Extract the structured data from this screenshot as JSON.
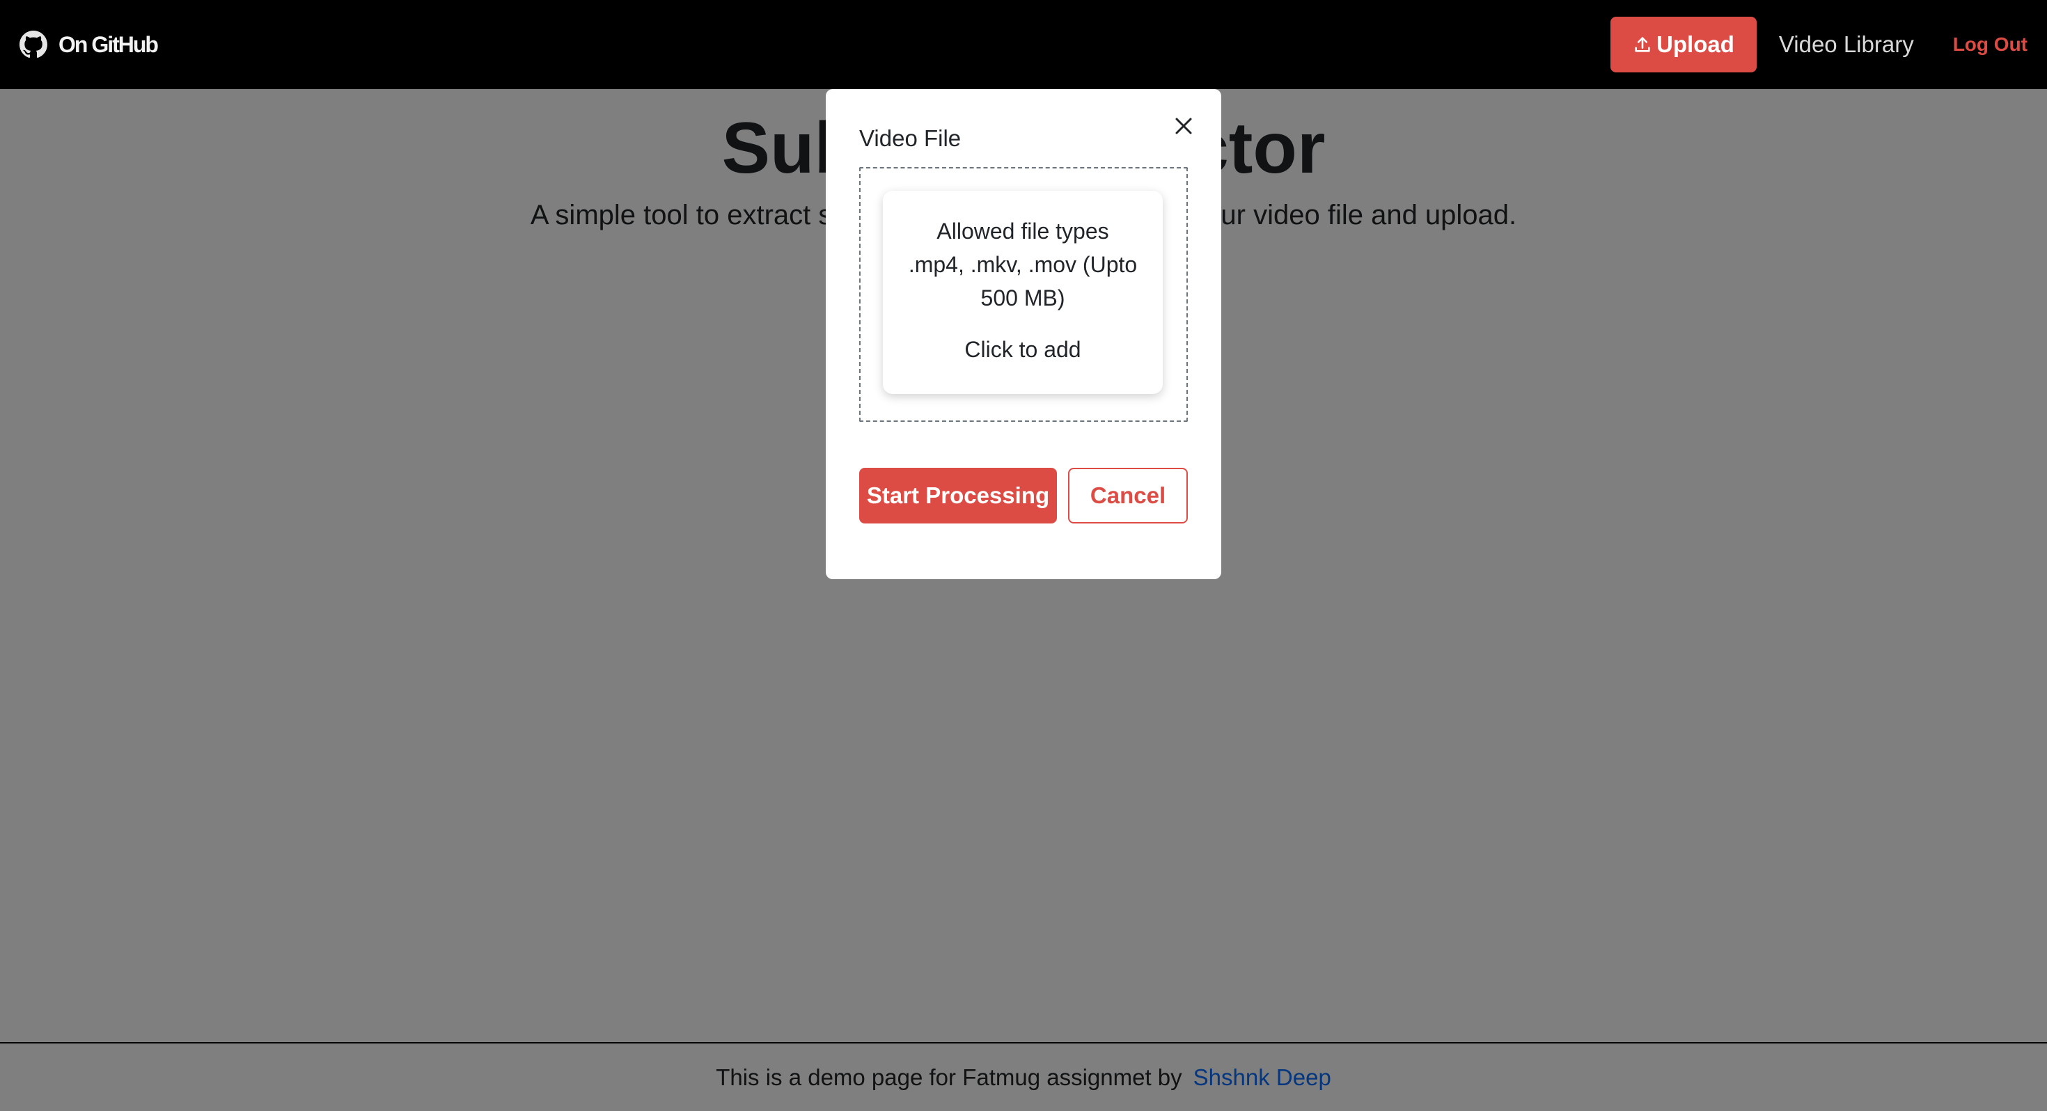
{
  "navbar": {
    "brand": "On GitHub",
    "upload_label": "Upload",
    "library_label": "Video Library",
    "logout_label": "Log Out"
  },
  "main": {
    "title": "Subtitle Extractor",
    "subtitle": "A simple tool to extract subtitles from videos. Choose your video file and upload."
  },
  "modal": {
    "label": "Video File",
    "drop_title": "Allowed file types",
    "drop_types": ".mp4, .mkv, .mov (Upto 500 MB)",
    "drop_action": "Click to add",
    "start_label": "Start Processing",
    "cancel_label": "Cancel"
  },
  "footer": {
    "text": "This is a demo page for Fatmug assignmet by",
    "link_text": "Shshnk Deep"
  },
  "colors": {
    "accent": "#dc4c45",
    "navbar_bg": "#000000",
    "link": "#0d6efd"
  }
}
